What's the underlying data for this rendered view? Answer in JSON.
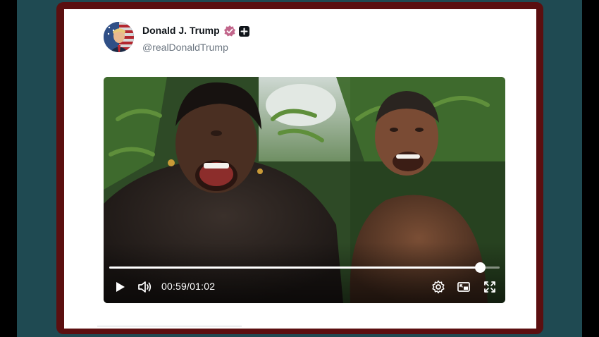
{
  "post": {
    "display_name": "Donald J. Trump",
    "handle": "@realDonaldTrump",
    "verified_icon": "verified-badge-icon",
    "extra_icon": "plus-square-icon",
    "avatar_icon": "profile-avatar"
  },
  "video": {
    "current_time": "00:59",
    "separator": "/",
    "duration": "01:02",
    "progress_fraction": 0.95,
    "controls": {
      "play_icon": "play-icon",
      "volume_icon": "volume-icon",
      "settings_icon": "gear-icon",
      "pip_icon": "picture-in-picture-icon",
      "fullscreen_icon": "fullscreen-icon"
    }
  },
  "colors": {
    "frame": "#5b0f10",
    "background": "#1f4a52",
    "verified_badge": "#c2668b"
  }
}
